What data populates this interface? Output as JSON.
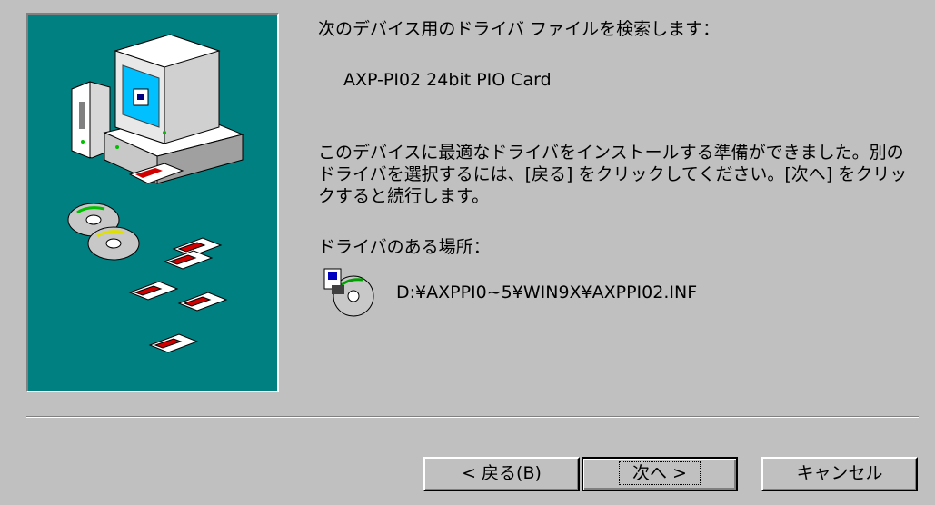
{
  "wizard": {
    "heading": "次のデバイス用のドライバ ファイルを検索します：",
    "device_name": "AXP-PI02 24bit PIO Card",
    "description": "このデバイスに最適なドライバをインストールする準備ができました。別のドライバを選択するには、[戻る] をクリックしてください。[次へ] をクリックすると続行します。",
    "location_label": "ドライバのある場所：",
    "driver_path": "D:¥AXPPI0~5¥WIN9X¥AXPPI02.INF"
  },
  "buttons": {
    "back": "< 戻る(B)",
    "next": "次へ >",
    "cancel": "キャンセル"
  },
  "icons": {
    "illustration": "computer-with-cds-and-floppies-illustration",
    "file": "driver-file-cd-icon"
  }
}
